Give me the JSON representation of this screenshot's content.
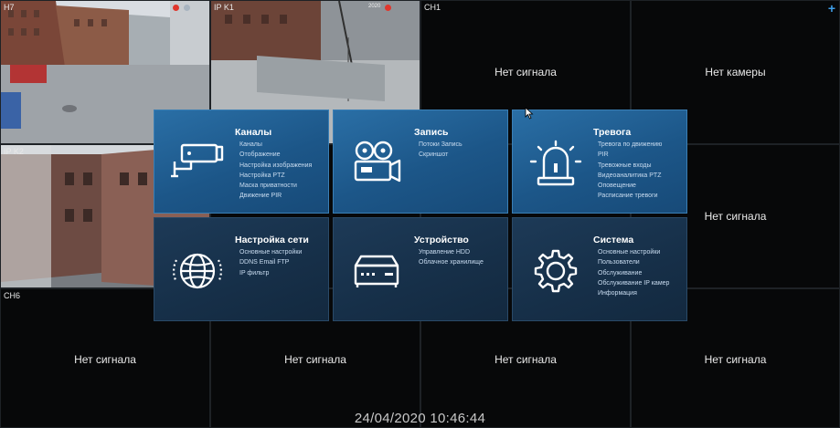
{
  "cells": {
    "ch7": {
      "label": "H7"
    },
    "ipk1": {
      "label": "IP K1",
      "timestamp": "2020"
    },
    "ch1": {
      "label": "CH1",
      "status": "Нет сигнала"
    },
    "cam4": {
      "status": "Нет камеры"
    },
    "ipk2": {
      "label": "IP K2"
    },
    "right_mid": {
      "status": "Нет сигнала"
    },
    "ch6": {
      "label": "CH6"
    },
    "bottom": [
      {
        "status": "Нет сигнала"
      },
      {
        "status": "Нет сигнала"
      },
      {
        "status": "Нет сигнала"
      },
      {
        "status": "Нет сигнала"
      }
    ]
  },
  "menu": {
    "channels": {
      "title": "Каналы",
      "items": [
        "Каналы",
        "Отображение",
        "Настройка изображения",
        "Настройка PTZ",
        "Маска приватности",
        "Движение    PIR"
      ]
    },
    "record": {
      "title": "Запись",
      "items": [
        "Потоки    Запись",
        "Скриншот"
      ]
    },
    "alarm": {
      "title": "Тревога",
      "items": [
        "Тревога по движению",
        "PIR",
        "Тревожные входы",
        "Видеоаналитика    PTZ",
        "Оповещение",
        "Расписание тревоги"
      ]
    },
    "network": {
      "title": "Настройка сети",
      "items": [
        "Основные настройки",
        "DDNS    Email    FTP",
        "IP фильтр"
      ]
    },
    "device": {
      "title": "Устройство",
      "items": [
        "Управление HDD",
        "Облачное хранилище"
      ]
    },
    "system": {
      "title": "Система",
      "items": [
        "Основные настройки",
        "Пользователи",
        "Обслуживание",
        "Обслуживание IP камер",
        "Информация"
      ]
    }
  },
  "datetime": "24/04/2020 10:46:44",
  "colors": {
    "accent": "#3f9ee8",
    "rec": "#e0362c",
    "tile": "#1c5688",
    "tile_dark": "#162f48"
  }
}
